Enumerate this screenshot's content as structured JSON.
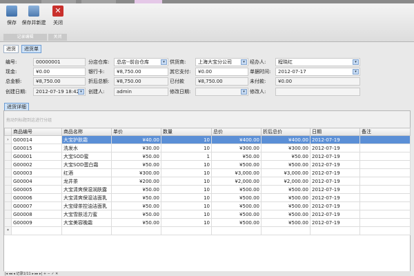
{
  "ribbon": {
    "buttons": [
      {
        "label": "保存",
        "icon": "save-icon"
      },
      {
        "label": "保存并新建",
        "icon": "save-new-icon"
      },
      {
        "label": "关闭",
        "icon": "close-icon"
      }
    ],
    "groups": [
      "记录编辑",
      "关闭"
    ]
  },
  "form_tabs": [
    "进货",
    "进货单"
  ],
  "form": {
    "bianhao": {
      "label": "编号:",
      "value": "00000001"
    },
    "cangku": {
      "label": "分店仓库:",
      "value": "总店--前台仓库"
    },
    "gonghuo": {
      "label": "供货商:",
      "value": "上海大宝分公司"
    },
    "jingban": {
      "label": "经办人:",
      "value": "程晓红"
    },
    "xianjin": {
      "label": "现金:",
      "value": "¥0.00"
    },
    "yinhang": {
      "label": "银行卡:",
      "value": "¥8,750.00"
    },
    "qita": {
      "label": "其它支付:",
      "value": "¥0.00"
    },
    "danju": {
      "label": "单据时间:",
      "value": "2012-07-17"
    },
    "zongjine": {
      "label": "总金额:",
      "value": "¥8,750.00"
    },
    "zhehou": {
      "label": "折后总额:",
      "value": "¥8,750.00"
    },
    "yifu": {
      "label": "已付款",
      "value": "¥8,750.00"
    },
    "weifu": {
      "label": "未付款:",
      "value": "¥0.00"
    },
    "chuangjian": {
      "label": "创建日期:",
      "value": "2012-07-19 18:42"
    },
    "chuangjianren": {
      "label": "创建人:",
      "value": "admin"
    },
    "xiugai": {
      "label": "修改日期:",
      "value": ""
    },
    "xiugairen": {
      "label": "修改人:",
      "value": ""
    }
  },
  "detail_tab": "进货详细",
  "group_hint": "拖动列标题到这进行分组",
  "grid": {
    "columns": [
      "商品编号",
      "商品名称",
      "单价",
      "数量",
      "总价",
      "折后总价",
      "日期",
      "备注"
    ],
    "rows": [
      [
        "G00014",
        "大宝护肤霜",
        "¥40.00",
        "10",
        "¥400.00",
        "¥400.00",
        "2012-07-19",
        ""
      ],
      [
        "G00015",
        "洗发水",
        "¥30.00",
        "10",
        "¥300.00",
        "¥300.00",
        "2012-07-19",
        ""
      ],
      [
        "G00001",
        "大宝SOD蜜",
        "¥50.00",
        "1",
        "¥50.00",
        "¥50.00",
        "2012-07-19",
        ""
      ],
      [
        "G00002",
        "大宝SOD蛋白霜",
        "¥50.00",
        "10",
        "¥500.00",
        "¥500.00",
        "2012-07-19",
        ""
      ],
      [
        "G00003",
        "红酒",
        "¥300.00",
        "10",
        "¥3,000.00",
        "¥3,000.00",
        "2012-07-19",
        ""
      ],
      [
        "G00004",
        "龙井茶",
        "¥200.00",
        "10",
        "¥2,000.00",
        "¥2,000.00",
        "2012-07-19",
        ""
      ],
      [
        "G00005",
        "大宝清爽保湿润肤露",
        "¥50.00",
        "10",
        "¥500.00",
        "¥500.00",
        "2012-07-19",
        ""
      ],
      [
        "G00006",
        "大宝清爽保湿洁面乳",
        "¥50.00",
        "10",
        "¥500.00",
        "¥500.00",
        "2012-07-19",
        ""
      ],
      [
        "G00007",
        "大宝绿茶控油洁面乳",
        "¥50.00",
        "10",
        "¥500.00",
        "¥500.00",
        "2012-07-19",
        ""
      ],
      [
        "G00008",
        "大宝雪肤活力蜜",
        "¥50.00",
        "10",
        "¥500.00",
        "¥500.00",
        "2012-07-19",
        ""
      ],
      [
        "G00009",
        "大宝美容晚霜",
        "¥50.00",
        "10",
        "¥500.00",
        "¥500.00",
        "2012-07-19",
        ""
      ]
    ]
  },
  "navigator": {
    "record": "记录1/11"
  },
  "colors": {
    "selection": "#5b8fd6",
    "accent_tab": "#cfe3f8",
    "close_red": "#c9302c"
  }
}
